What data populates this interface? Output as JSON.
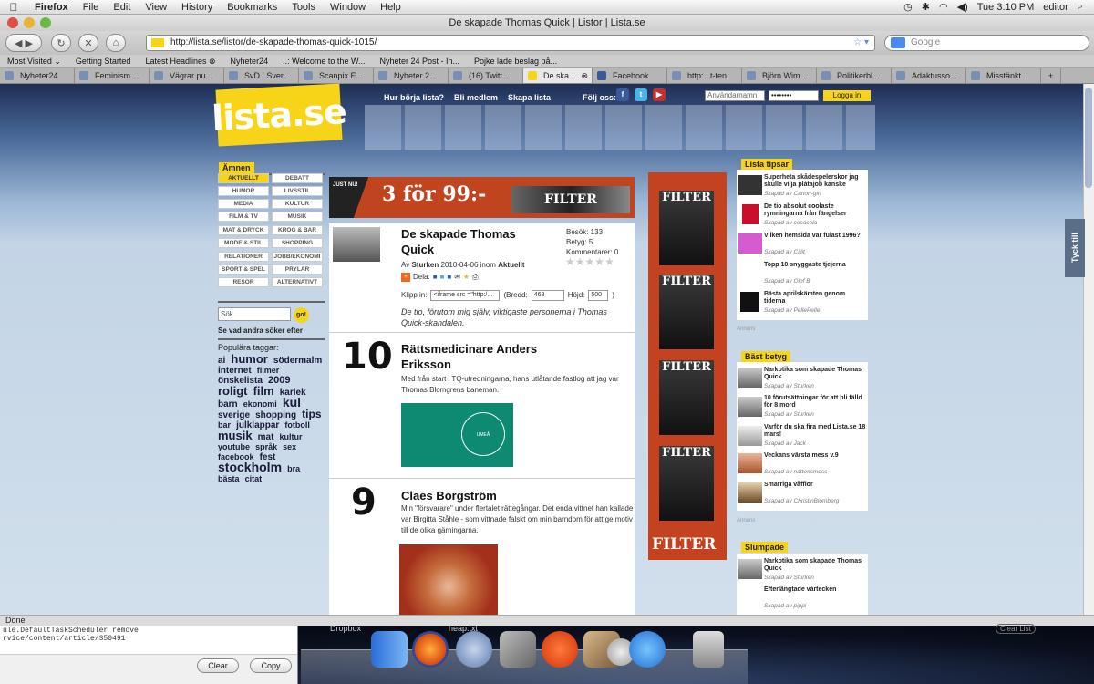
{
  "menubar": {
    "app": "Firefox",
    "items": [
      "File",
      "Edit",
      "View",
      "History",
      "Bookmarks",
      "Tools",
      "Window",
      "Help"
    ],
    "clock": "Tue 3:10 PM",
    "user": "editor"
  },
  "window": {
    "title": "De skapade Thomas Quick | Listor | Lista.se"
  },
  "toolbar": {
    "url": "http://lista.se/listor/de-skapade-thomas-quick-1015/",
    "search_placeholder": "Google"
  },
  "bookmarks": [
    "Most Visited ⌄",
    "Getting Started",
    "Latest Headlines ⊗",
    "Nyheter24",
    "..: Welcome to the W...",
    "Nyheter 24 Post - In...",
    "Pojke lade beslag på..."
  ],
  "tabs": [
    "Nyheter24",
    "Feminism ...",
    "Vägrar pu...",
    "SvD | Sver...",
    "Scanpix E...",
    "Nyheter 2...",
    "(16) Twitt...",
    "De ska...",
    "Facebook",
    "http:...t-ten",
    "Björn Wim...",
    "Politikerbl...",
    "Adaktusso...",
    "Misstänkt..."
  ],
  "site": {
    "logo": "lista.se",
    "nav": [
      "Hur börja lista?",
      "Bli medlem",
      "Skapa lista"
    ],
    "follow": "Följ oss:",
    "username_placeholder": "Användarnamn",
    "password_value": "••••••••",
    "login": "Logga in",
    "feedback": "Tyck till"
  },
  "sidebar": {
    "amnen": "Ämnen",
    "categories": [
      [
        "AKTUELLT",
        "DEBATT"
      ],
      [
        "HUMOR",
        "LIVSSTIL"
      ],
      [
        "MEDIA",
        "KULTUR"
      ],
      [
        "FILM & TV",
        "MUSIK"
      ],
      [
        "MAT & DRYCK",
        "KROG & BAR"
      ],
      [
        "MODE & STIL",
        "SHOPPING"
      ],
      [
        "RELATIONER",
        "JOBB/EKONOMI"
      ],
      [
        "SPORT & SPEL",
        "PRYLAR"
      ],
      [
        "RESOR",
        "ALTERNATIVT"
      ]
    ],
    "search_value": "Sök",
    "search_button": "go!",
    "see_others": "Se vad andra söker efter",
    "popular_tags": "Populära taggar:",
    "tags": [
      {
        "t": "ai",
        "s": 10
      },
      {
        "t": "humor",
        "s": 13
      },
      {
        "t": "södermalm",
        "s": 10
      },
      {
        "t": "internet",
        "s": 10
      },
      {
        "t": "filmer",
        "s": 9
      },
      {
        "t": "önskelista",
        "s": 10
      },
      {
        "t": "2009",
        "s": 11
      },
      {
        "t": "roligt",
        "s": 13
      },
      {
        "t": "film",
        "s": 13
      },
      {
        "t": "kärlek",
        "s": 10
      },
      {
        "t": "barn",
        "s": 10
      },
      {
        "t": "ekonomi",
        "s": 9
      },
      {
        "t": "kul",
        "s": 14
      },
      {
        "t": "sverige",
        "s": 10
      },
      {
        "t": "shopping",
        "s": 10
      },
      {
        "t": "tips",
        "s": 12
      },
      {
        "t": "bar",
        "s": 9
      },
      {
        "t": "julklappar",
        "s": 10
      },
      {
        "t": "fotboll",
        "s": 9
      },
      {
        "t": "musik",
        "s": 13
      },
      {
        "t": "mat",
        "s": 10
      },
      {
        "t": "kultur",
        "s": 9
      },
      {
        "t": "youtube",
        "s": 9
      },
      {
        "t": "språk",
        "s": 9
      },
      {
        "t": "sex",
        "s": 9
      },
      {
        "t": "facebook",
        "s": 9
      },
      {
        "t": "fest",
        "s": 10
      },
      {
        "t": "stockholm",
        "s": 14
      },
      {
        "t": "bra",
        "s": 9
      },
      {
        "t": "bästa",
        "s": 9
      },
      {
        "t": "citat",
        "s": 9
      }
    ]
  },
  "banner": {
    "text": "3 för 99:-",
    "tag": "JUST NU!",
    "brand": "FILTER"
  },
  "article": {
    "title": "De skapade Thomas Quick",
    "stats": {
      "visits": "Besök: 133",
      "rating": "Betyg: 5",
      "comments": "Kommentarer: 0"
    },
    "byline": {
      "prefix": "Av",
      "author": "Sturken",
      "date": "2010-04-06 inom",
      "category": "Aktuellt"
    },
    "share_label": "Dela:",
    "embed_label": "Klipp in:",
    "embed_value": "<iframe src =\"http:/...",
    "width_label": "(Bredd:",
    "width_value": "468",
    "height_label": "Höjd:",
    "height_value": "500",
    "close_paren": ")",
    "intro": "De tio, förutom mig själv, viktigaste personerna i Thomas Quick-skandalen.",
    "entries": [
      {
        "rank": "10",
        "title": "Rättsmedicinare Anders Eriksson",
        "text": "Med från start i TQ-utredningarna, hans utlåtande fastlog att jag var Thomas Blomgrens baneman.",
        "image": "UMEÅ UNIVERSITET"
      },
      {
        "rank": "9",
        "title": "Claes Borgström",
        "text": "Min \"försvarare\" under flertalet rättegångar. Det enda vittnet han kallade var Birgitta Ståhle - som vittnade falskt om min barndom för att ge motiv till de olika gärningarna."
      }
    ]
  },
  "filter_ad": {
    "covers": [
      "FILTER",
      "FILTER",
      "FILTER",
      "FILTER"
    ],
    "brand": "FILTER"
  },
  "right": {
    "lista_tipsar": {
      "label": "Lista tipsar",
      "items": [
        {
          "title": "Superheta skådespelerskor jag skulle vilja plåtajob kanske",
          "sub": "Skapad av Canon-girl"
        },
        {
          "title": "De tio absolut coolaste rymningarna från fängelser",
          "sub": "Skapad av cocacola"
        },
        {
          "title": "Vilken hemsida var fulast 1996?",
          "sub": "Skapad av Cillit"
        },
        {
          "title": "Topp 10 snyggaste tjejerna",
          "sub": "Skapad av Olof B"
        },
        {
          "title": "Bästa aprilskämten genom tiderna",
          "sub": "Skapad av PellePelle"
        }
      ],
      "footer": "Annons"
    },
    "bast_betyg": {
      "label": "Bäst betyg",
      "items": [
        {
          "title": "Narkotika som skapade Thomas Quick",
          "sub": "Skapad av Sturken"
        },
        {
          "title": "10 förutsättningar för att bli fälld för 8 mord",
          "sub": "Skapad av Sturken"
        },
        {
          "title": "Varför du ska fira med Lista.se 18 mars!",
          "sub": "Skapad av Jack"
        },
        {
          "title": "Veckans värsta mess v.9",
          "sub": "Skapad av nattensmess"
        },
        {
          "title": "Smarriga våfflor",
          "sub": "Skapad av ChristinBlomberg"
        }
      ],
      "footer": "Annons"
    },
    "slumpade": {
      "label": "Slumpade",
      "items": [
        {
          "title": "Narkotika som skapade Thomas Quick",
          "sub": "Skapad av Sturken"
        },
        {
          "title": "Efterlängtade vårtecken",
          "sub": "Skapad av pippi"
        }
      ]
    }
  },
  "status": "Done",
  "console": {
    "lines": [
      "ule.DefaultTaskScheduler remove",
      "rvice/content/article/350491"
    ],
    "clear": "Clear",
    "copy": "Copy"
  },
  "dock": {
    "labels": [
      "Dropbox",
      "heap.txt",
      "Clear List"
    ]
  }
}
